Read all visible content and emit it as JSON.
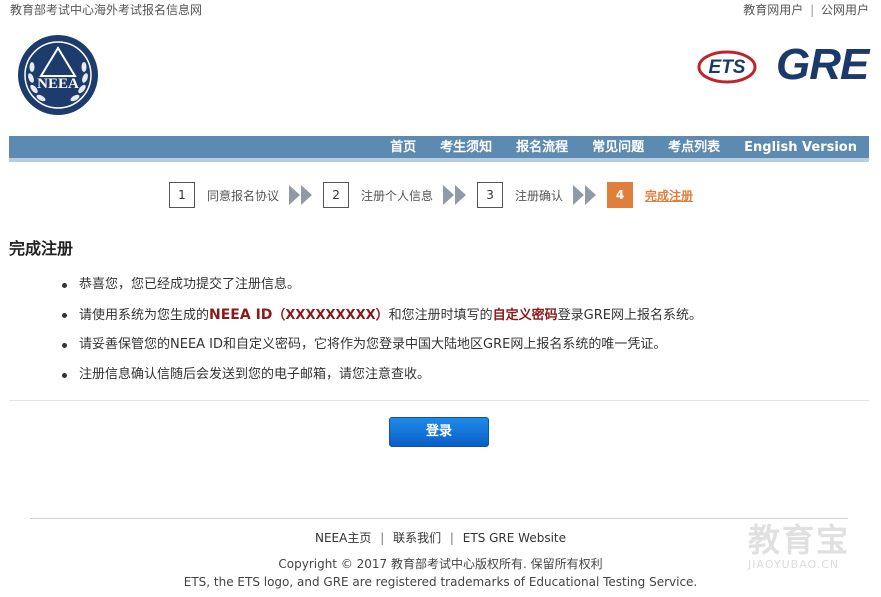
{
  "top_bar": {
    "site_name": "教育部考试中心海外考试报名信息网",
    "user_links": [
      "教育网用户",
      "公网用户"
    ],
    "separator": "|"
  },
  "logos": {
    "neea_text": "NEEA",
    "ets_text": "ETS",
    "gre_text": "GRE"
  },
  "nav": {
    "items": [
      "首页",
      "考生须知",
      "报名流程",
      "常见问题",
      "考点列表",
      "English Version"
    ]
  },
  "steps": [
    {
      "num": "1",
      "label": "同意报名协议",
      "active": false
    },
    {
      "num": "2",
      "label": "注册个人信息",
      "active": false
    },
    {
      "num": "3",
      "label": "注册确认",
      "active": false
    },
    {
      "num": "4",
      "label": "完成注册",
      "active": true
    }
  ],
  "main": {
    "title": "完成注册",
    "messages": {
      "m1": "恭喜您，您已经成功提交了注册信息。",
      "m2_pre": "请使用系统为您生成的",
      "m2_id_label": "NEEA ID",
      "m2_id_value": "（XXXXXXXXX）",
      "m2_mid": "和您注册时填写的",
      "m2_pwd": "自定义密码",
      "m2_post": "登录GRE网上报名系统。",
      "m3": "请妥善保管您的NEEA ID和自定义密码，它将作为您登录中国大陆地区GRE网上报名系统的唯一凭证。",
      "m4": "注册信息确认信随后会发送到您的电子邮箱，请您注意查收。"
    },
    "login_button": "登录"
  },
  "footer": {
    "links": [
      "NEEA主页",
      "联系我们",
      "ETS GRE Website"
    ],
    "separator": "|",
    "copyright": "Copyright © 2017 教育部考试中心版权所有. 保留所有权利",
    "trademark": "ETS, the ETS logo, and GRE are registered trademarks of Educational Testing Service."
  },
  "watermark": {
    "text": "教育宝",
    "sub": "JIAOYUBAO.CN"
  },
  "colors": {
    "nav_bg": "#5d8ab0",
    "accent_orange": "#e07e3c",
    "highlight_red": "#8b1a1a",
    "button_blue": "#0a5fc7",
    "brand_navy": "#1b3a6b"
  }
}
